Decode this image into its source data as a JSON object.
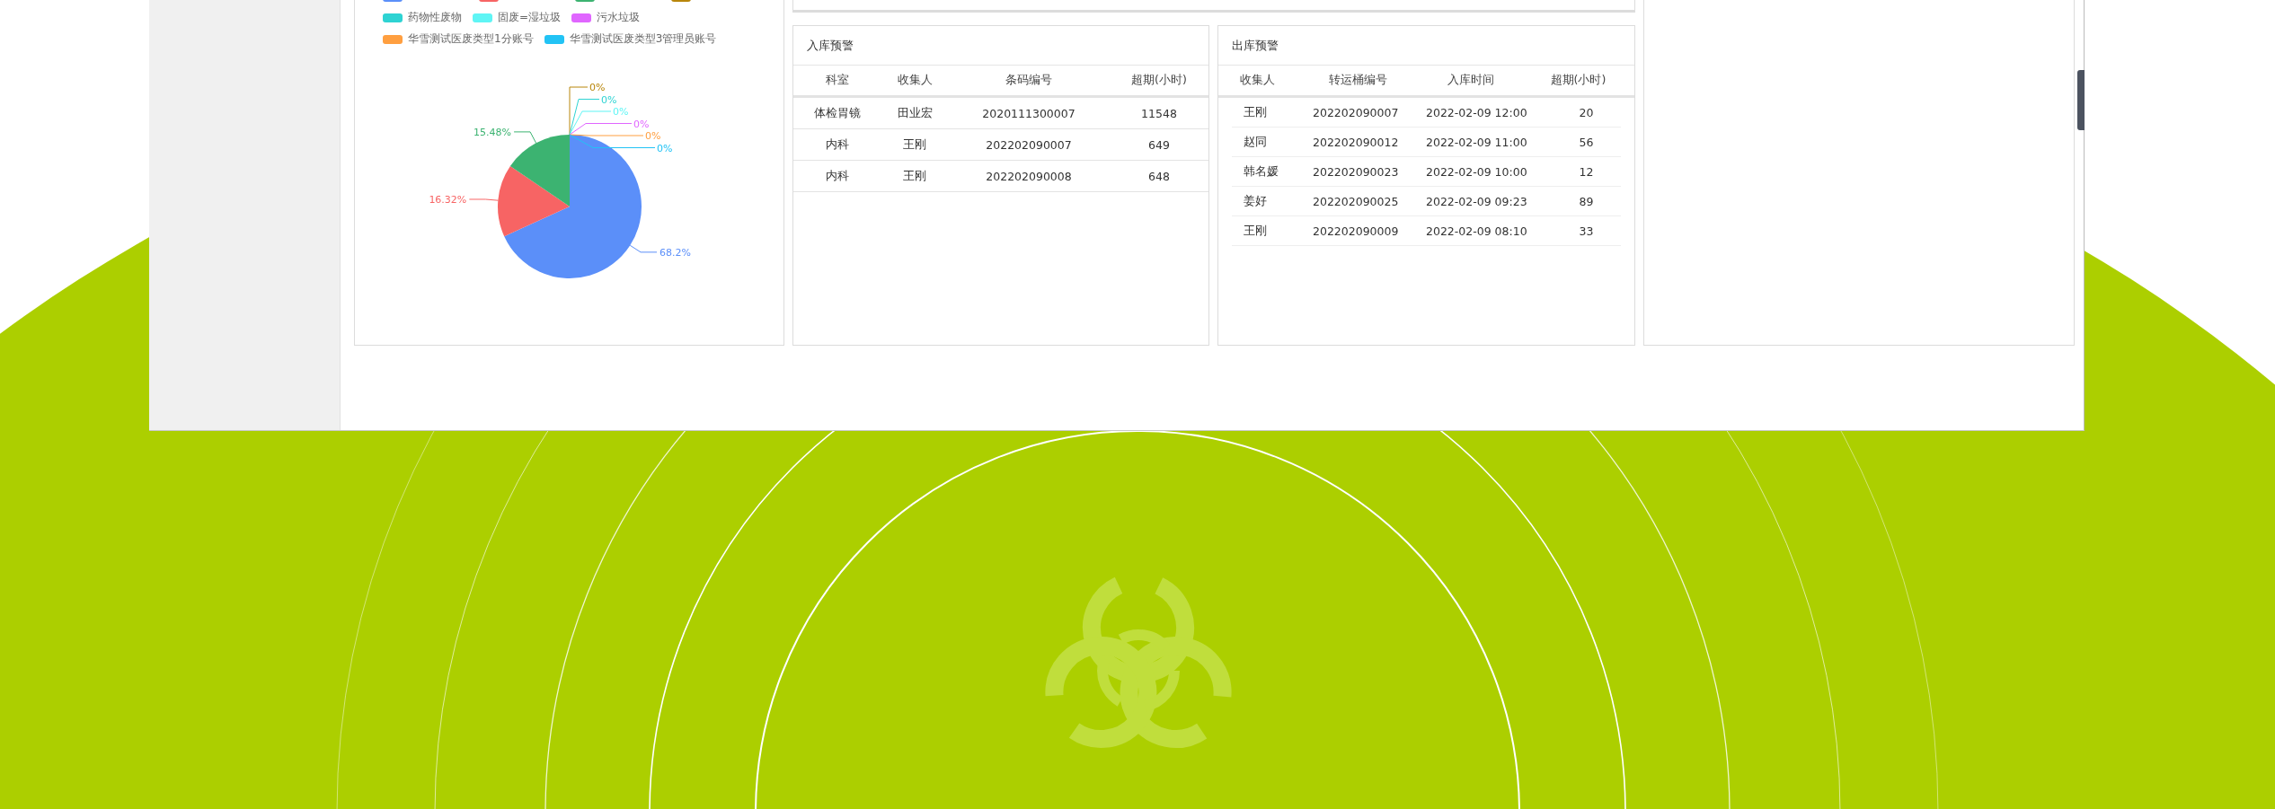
{
  "waste_chart": {
    "legend": [
      {
        "color": "#5b8ff9"
      },
      {
        "color": "#f76464"
      },
      {
        "color": "#3cb371"
      },
      {
        "color": "#b8860b"
      },
      {
        "color": "#2ed3d3",
        "label": "药物性废物"
      },
      {
        "color": "#5ff5f5",
        "label": "固废=湿垃圾"
      },
      {
        "color": "#e066ff",
        "label": "污水垃圾"
      },
      {
        "color": "#ff9f40",
        "label": "华雪测试医废类型1分账号"
      },
      {
        "color": "#22c3f5",
        "label": "华雪测试医废类型3管理员账号"
      }
    ],
    "chart_data": {
      "type": "pie",
      "values": [
        68.2,
        16.32,
        15.48,
        0,
        0,
        0,
        0,
        0,
        0
      ],
      "value_labels": [
        "68.2%",
        "16.32%",
        "15.48%",
        "0%",
        "0%",
        "0%",
        "0%",
        "0%",
        "0%"
      ]
    }
  },
  "inbound_warning": {
    "title": "入库预警",
    "columns": [
      "科室",
      "收集人",
      "条码编号",
      "超期(小时)"
    ],
    "rows": [
      [
        "体检胃镜",
        "田业宏",
        "2020111300007",
        "11548"
      ],
      [
        "内科",
        "王刚",
        "202202090007",
        "649"
      ],
      [
        "内科",
        "王刚",
        "202202090008",
        "648"
      ]
    ]
  },
  "outbound_warning": {
    "title": "出库预警",
    "columns": [
      "收集人",
      "转运桶编号",
      "入库时间",
      "超期(小时)"
    ],
    "rows": [
      [
        "王刚",
        "202202090007",
        "2022-02-09 12:00",
        "20"
      ],
      [
        "赵同",
        "202202090012",
        "2022-02-09 11:00",
        "56"
      ],
      [
        "韩名媛",
        "202202090023",
        "2022-02-09 10:00",
        "12"
      ],
      [
        "姜好",
        "202202090025",
        "2022-02-09 09:23",
        "89"
      ],
      [
        "王刚",
        "202202090009",
        "2022-02-09 08:10",
        "33"
      ]
    ]
  }
}
